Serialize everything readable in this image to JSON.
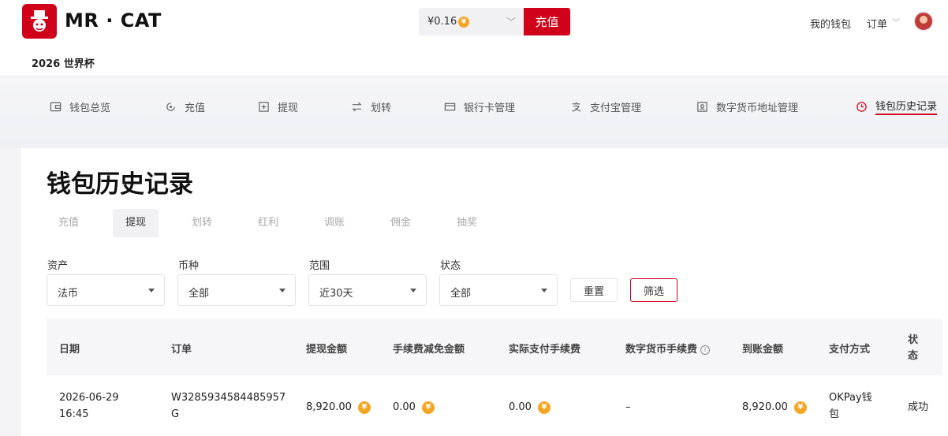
{
  "header": {
    "brand": "MR · CAT",
    "subtitle": "2026 世界杯",
    "balance": "¥0.16",
    "coin_symbol": "¥",
    "recharge_button": "充值",
    "wallet_link": "我的钱包",
    "orders_link": "订单"
  },
  "nav": {
    "items": [
      {
        "label": "钱包总览",
        "icon": "wallet-icon"
      },
      {
        "label": "充值",
        "icon": "recharge-icon"
      },
      {
        "label": "提现",
        "icon": "withdraw-icon"
      },
      {
        "label": "划转",
        "icon": "transfer-icon"
      },
      {
        "label": "银行卡管理",
        "icon": "bank-card-icon"
      },
      {
        "label": "支付宝管理",
        "icon": "alipay-icon"
      },
      {
        "label": "数字货币地址管理",
        "icon": "crypto-address-icon"
      },
      {
        "label": "钱包历史记录",
        "icon": "history-clock-icon",
        "active": true
      }
    ]
  },
  "page": {
    "title": "钱包历史记录",
    "tabs": [
      "充值",
      "提现",
      "划转",
      "红利",
      "调账",
      "佣金",
      "抽奖"
    ],
    "active_tab": "提现"
  },
  "filters": {
    "asset": {
      "label": "资产",
      "value": "法币"
    },
    "currency": {
      "label": "币种",
      "value": "全部"
    },
    "range": {
      "label": "范围",
      "value": "近30天"
    },
    "status": {
      "label": "状态",
      "value": "全部"
    },
    "reset_button": "重置",
    "filter_button": "筛选"
  },
  "table": {
    "columns": [
      "日期",
      "订单",
      "提现金额",
      "手续费减免金额",
      "实际支付手续费",
      "数字货币手续费",
      "到账金额",
      "支付方式",
      "状态"
    ],
    "rows": [
      {
        "date_line1": "2026-06-29",
        "date_line2": "16:45",
        "order_line1": "W3285934584485957",
        "order_line2": "G",
        "amount": "8,920.00",
        "fee_waiver": "0.00",
        "actual_fee": "0.00",
        "crypto_fee": "–",
        "received": "8,920.00",
        "method_line1": "OKPay钱",
        "method_line2": "包",
        "status": "成功"
      }
    ]
  },
  "colors": {
    "brand_red": "#d0021b",
    "coin_gold": "#f5a623"
  }
}
